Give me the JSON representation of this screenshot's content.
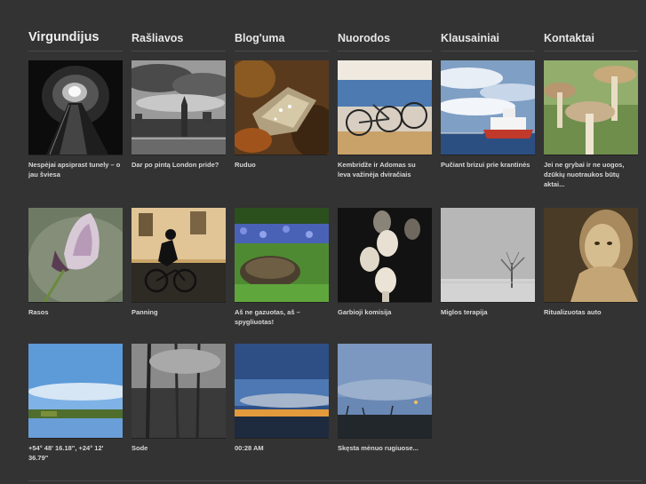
{
  "nav": {
    "brand": "Virgundijus",
    "items": [
      "Rašliavos",
      "Blog'uma",
      "Nuorodos",
      "Klausainiai",
      "Kontaktai"
    ]
  },
  "gallery": [
    {
      "caption": "Nespėjai apsiprast tunely – o jau šviesa",
      "icon": "tunnel-photo"
    },
    {
      "caption": "Dar po pintą London pride?",
      "icon": "london-photo"
    },
    {
      "caption": "Ruduo",
      "icon": "autumn-leaf-photo"
    },
    {
      "caption": "Kembridže ir Adomas su leva važinėja dviračiais",
      "icon": "bicycles-photo"
    },
    {
      "caption": "Pučiant brizui prie krantinės",
      "icon": "ship-photo"
    },
    {
      "caption": "Jei ne grybai ir ne uogos, dzūkių nuotraukos būtų aktai...",
      "icon": "mushrooms-photo"
    },
    {
      "caption": "Rasos",
      "icon": "flower-photo"
    },
    {
      "caption": "Panning",
      "icon": "cyclist-photo"
    },
    {
      "caption": "Aš ne gazuotas, aš – spygliuotas!",
      "icon": "hedgehog-photo"
    },
    {
      "caption": "Garbioji komisija",
      "icon": "heads-photo"
    },
    {
      "caption": "Miglos terapija",
      "icon": "foggy-tree-photo"
    },
    {
      "caption": "Ritualizuotas auto",
      "icon": "old-woman-photo"
    },
    {
      "caption": "+54° 48' 16.18\", +24° 12' 36.79\"",
      "icon": "landscape-photo"
    },
    {
      "caption": "Sode",
      "icon": "garden-photo"
    },
    {
      "caption": "00:28 AM",
      "icon": "sunset-photo"
    },
    {
      "caption": "Skęsta mėnuo rugiuose...",
      "icon": "moon-field-photo"
    }
  ]
}
